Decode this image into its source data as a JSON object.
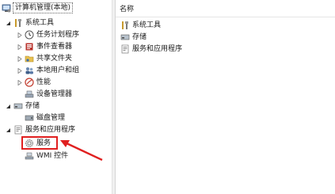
{
  "tree": {
    "root": "计算机管理(本地)",
    "items": [
      {
        "label": "系统工具",
        "icon": "tools-icon"
      },
      {
        "label": "任务计划程序",
        "icon": "clock-icon"
      },
      {
        "label": "事件查看器",
        "icon": "event-viewer-icon"
      },
      {
        "label": "共享文件夹",
        "icon": "shared-folder-icon"
      },
      {
        "label": "本地用户和组",
        "icon": "users-icon"
      },
      {
        "label": "性能",
        "icon": "performance-icon"
      },
      {
        "label": "设备管理器",
        "icon": "device-manager-icon"
      },
      {
        "label": "存储",
        "icon": "storage-icon"
      },
      {
        "label": "磁盘管理",
        "icon": "disk-icon"
      },
      {
        "label": "服务和应用程序",
        "icon": "services-apps-icon"
      },
      {
        "label": "服务",
        "icon": "services-gear-icon"
      },
      {
        "label": "WMI 控件",
        "icon": "wmi-icon"
      }
    ]
  },
  "list": {
    "header": "名称",
    "items": [
      {
        "label": "系统工具",
        "icon": "tools-icon"
      },
      {
        "label": "存储",
        "icon": "storage-icon"
      },
      {
        "label": "服务和应用程序",
        "icon": "services-apps-icon"
      }
    ]
  },
  "annotation": {
    "color": "#e02020"
  }
}
